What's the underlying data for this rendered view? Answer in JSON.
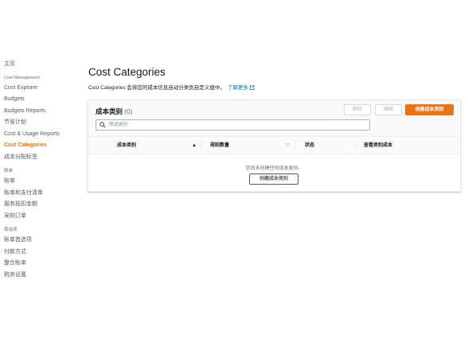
{
  "sidebar": {
    "home": "主页",
    "sections": [
      {
        "title": "Cost Management",
        "items": [
          "Cost Explorer",
          "Budgets",
          "Budgets Reports",
          "节省计划",
          "Cost & Usage Reports",
          "Cost Categories",
          "成本分配标签"
        ]
      },
      {
        "title": "账单",
        "items": [
          "账单",
          "账单和支付清单",
          "服务抵扣金额",
          "采购订单"
        ]
      },
      {
        "title": "首选项",
        "items": [
          "账单首选项",
          "付款方式",
          "整合账单",
          "税务设置"
        ]
      }
    ],
    "active_item": "Cost Categories"
  },
  "main": {
    "title": "Cost Categories",
    "description": "Cost Categories 会将您的成本信息自动分类到自定义组中。",
    "learn_more": "了解更多"
  },
  "panel": {
    "title": "成本类别",
    "count": "(0)",
    "buttons": {
      "delete": "删除",
      "edit": "编辑",
      "create": "创建成本类别"
    },
    "search_placeholder": "筛选类别",
    "columns": [
      "成本类别",
      "规则数量",
      "状态",
      "查看类别成本"
    ],
    "empty_message": "您尚未创建任何成本类别。",
    "empty_create": "创建成本类别"
  },
  "colors": {
    "accent": "#ec7211",
    "link": "#0073bb"
  },
  "icons": {
    "search": "search-icon",
    "external": "external-link-icon",
    "sort_asc": "sort-ascending-icon",
    "sort": "sort-icon"
  }
}
